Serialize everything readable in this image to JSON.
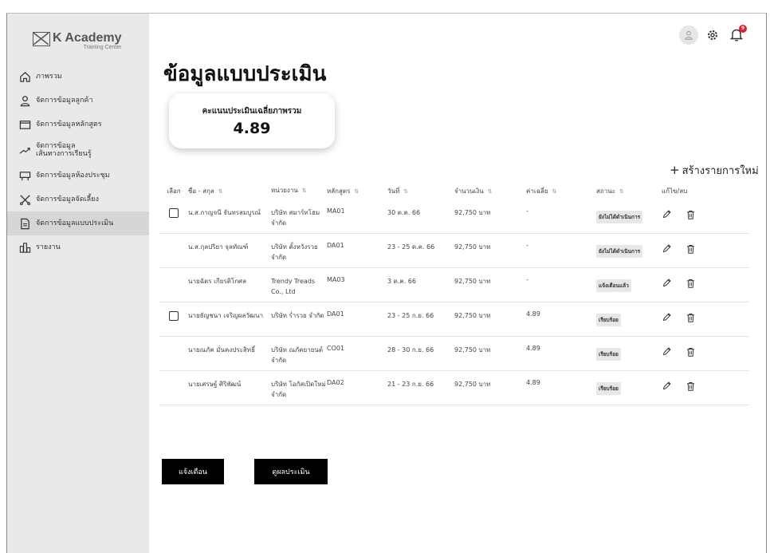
{
  "brand": {
    "title": "K Academy",
    "subtitle": "Training Center"
  },
  "sidebar": {
    "items": [
      {
        "label": "ภาพรวม",
        "icon": "home-icon",
        "active": false
      },
      {
        "label": "จัดการข้อมูลลูกค้า",
        "icon": "user-icon",
        "active": false
      },
      {
        "label": "จัดการข้อมูลหลักสูตร",
        "icon": "folder-icon",
        "active": false
      },
      {
        "label": "จัดการข้อมูล\nเส้นทางการเรียนรู้",
        "icon": "trend-icon",
        "active": false
      },
      {
        "label": "จัดการข้อมูลห้องประชุม",
        "icon": "meeting-room-icon",
        "active": false
      },
      {
        "label": "จัดการข้อมูลจัดเลี้ยง",
        "icon": "utensils-icon",
        "active": false
      },
      {
        "label": "จัดการข้อมูลแบบประเมิน",
        "icon": "document-icon",
        "active": true
      },
      {
        "label": "รายงาน",
        "icon": "report-icon",
        "active": false
      }
    ]
  },
  "header": {
    "notification_count": "9"
  },
  "page": {
    "title": "ข้อมูลแบบประเมิน",
    "score_label": "คะแนนประเมินเฉลี่ยภาพรวม",
    "score_value": "4.89",
    "create_label": "สร้างรายการใหม่"
  },
  "table": {
    "columns": {
      "select": "เลือก",
      "name": "ชื่อ - สกุล",
      "unit": "หน่วยงาน",
      "course": "หลักสูตร",
      "date": "วันที่",
      "amount": "จำนวนเงิน",
      "avg": "ค่าเฉลี่ย",
      "status": "สถานะ",
      "actions": "แก้ไข/ลบ"
    },
    "rows": [
      {
        "checkbox": true,
        "name": "น.ส.กาญจนี จันทรสมบูรณ์",
        "unit": "บริษัท สมาร์ทโฮม จำกัด",
        "course": "MA01",
        "date": "30 ต.ค. 66",
        "amount": "92,750 บาท",
        "avg": "-",
        "status": "ยังไม่ได้ดำเนินการ"
      },
      {
        "checkbox": false,
        "name": "น.ส.กุลปริยา จุลทัณฑ์",
        "unit": "บริษัท ตั้งหวังรวย จำกัด",
        "course": "DA01",
        "date": "23 - 25 ต.ค. 66",
        "amount": "92,750 บาท",
        "avg": "-",
        "status": "ยังไม่ได้ดำเนินการ"
      },
      {
        "checkbox": false,
        "name": "นายฉัตร เกียรติโกศล",
        "unit": "Trendy Treads Co., Ltd",
        "course": "MA03",
        "date": "3 ต.ค. 66",
        "amount": "92,750 บาท",
        "avg": "-",
        "status": "แจ้งเตือนแล้ว"
      },
      {
        "checkbox": true,
        "name": "นายธัญชนา เจริญผลวัฒนา",
        "unit": "บริษัท ร่ำรวย จำกัด",
        "course": "DA01",
        "date": "23 - 25 ก.ย. 66",
        "amount": "92,750 บาท",
        "avg": "4.89",
        "status": "เรียบร้อย"
      },
      {
        "checkbox": false,
        "name": "นายณภัค มั่นคงประสิทธิ์",
        "unit": "บริษัท ณภัคยายนต์ จำกัด",
        "course": "CO01",
        "date": "28 - 30 ก.ย. 66",
        "amount": "92,750 บาท",
        "avg": "4.89",
        "status": "เรียบร้อย"
      },
      {
        "checkbox": false,
        "name": "นายเศรษฐ์ ศิริพัฒน์",
        "unit": "บริษัท โอกัสเปิดใหม่ จำกัด",
        "course": "DA02",
        "date": "21 - 23 ก.ย. 66",
        "amount": "92,750 บาท",
        "avg": "4.89",
        "status": "เรียบร้อย"
      }
    ]
  },
  "buttons": {
    "remind": "แจ้งเตือน",
    "view": "ดูผลประเมิน"
  }
}
